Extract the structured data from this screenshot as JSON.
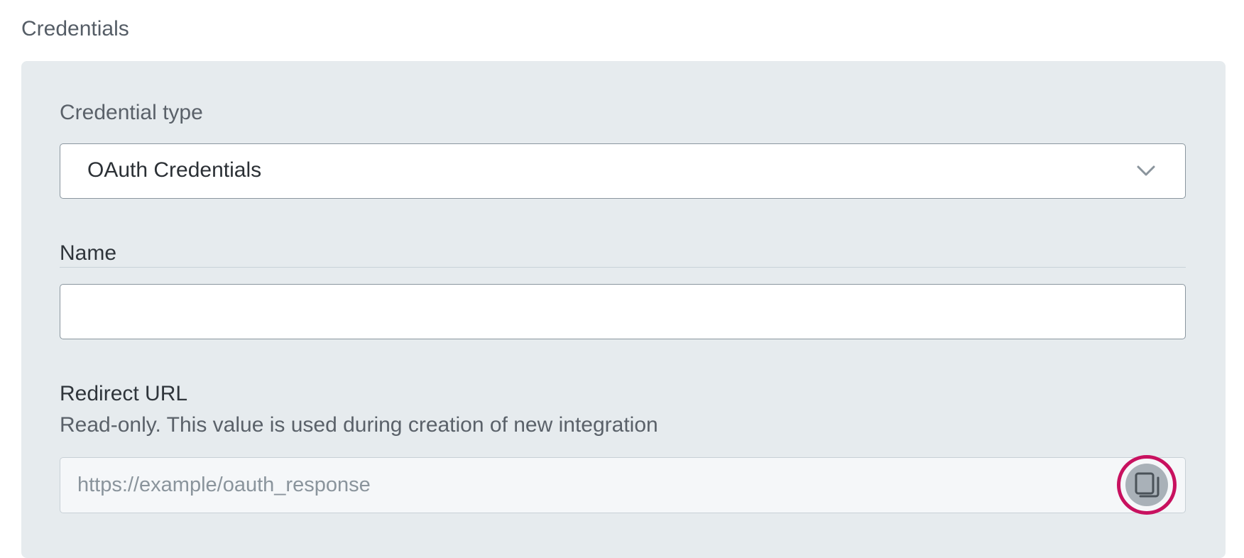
{
  "section": {
    "title": "Credentials"
  },
  "credential_type": {
    "label": "Credential type",
    "selected": "OAuth Credentials"
  },
  "name": {
    "label": "Name",
    "value": "",
    "placeholder": ""
  },
  "redirect_url": {
    "label": "Redirect URL",
    "help": "Read-only. This value is used during creation of new integration",
    "value": "https://example/oauth_response",
    "copy_icon": "copy-icon"
  },
  "colors": {
    "panel_bg": "#e6ebee",
    "highlight_ring": "#c8115f"
  }
}
